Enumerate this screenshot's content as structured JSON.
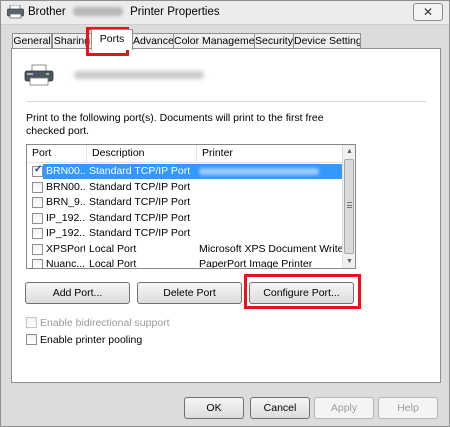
{
  "window": {
    "title_prefix": "Brother",
    "title_suffix": "Printer Properties",
    "close_glyph": "✕"
  },
  "tabs": [
    {
      "label": "General",
      "active": false
    },
    {
      "label": "Sharing",
      "active": false
    },
    {
      "label": "Ports",
      "active": true
    },
    {
      "label": "Advanced",
      "active": false
    },
    {
      "label": "Color Management",
      "active": false
    },
    {
      "label": "Security",
      "active": false
    },
    {
      "label": "Device Settings",
      "active": false
    }
  ],
  "ports_tab": {
    "printer_icon": "printer-icon",
    "description_line1": "Print to the following port(s). Documents will print to the first free",
    "description_line2": "checked port.",
    "columns": {
      "port": "Port",
      "description": "Description",
      "printer": "Printer"
    },
    "rows": [
      {
        "port": "BRN00...",
        "description": "Standard TCP/IP Port",
        "printer": "",
        "checked": true,
        "selected": true
      },
      {
        "port": "BRN00...",
        "description": "Standard TCP/IP Port",
        "printer": "",
        "checked": false,
        "selected": false
      },
      {
        "port": "BRN_9...",
        "description": "Standard TCP/IP Port",
        "printer": "",
        "checked": false,
        "selected": false
      },
      {
        "port": "IP_192....",
        "description": "Standard TCP/IP Port",
        "printer": "",
        "checked": false,
        "selected": false
      },
      {
        "port": "IP_192....",
        "description": "Standard TCP/IP Port",
        "printer": "",
        "checked": false,
        "selected": false
      },
      {
        "port": "XPSPort:",
        "description": "Local Port",
        "printer": "Microsoft XPS Document Writer",
        "checked": false,
        "selected": false
      },
      {
        "port": "Nuanc...",
        "description": "Local Port",
        "printer": "PaperPort Image Printer",
        "checked": false,
        "selected": false
      }
    ],
    "buttons": {
      "add_port": "Add Port...",
      "delete_port": "Delete Port",
      "configure_port": "Configure Port..."
    },
    "options": {
      "bidirectional": {
        "label": "Enable bidirectional support",
        "checked": false,
        "disabled": true
      },
      "pooling": {
        "label": "Enable printer pooling",
        "checked": false,
        "disabled": false
      }
    }
  },
  "dialog_buttons": {
    "ok": "OK",
    "cancel": "Cancel",
    "apply": "Apply",
    "help": "Help"
  },
  "colors": {
    "selection": "#3399ff",
    "highlight_box": "#e8121c"
  }
}
